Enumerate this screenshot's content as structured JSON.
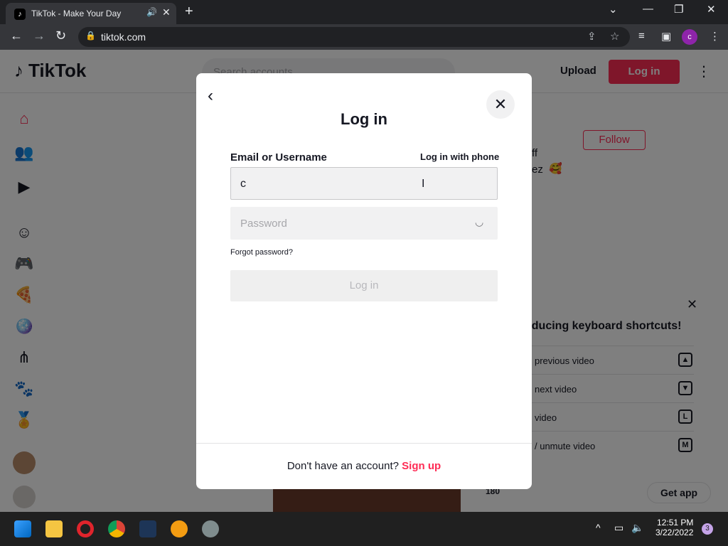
{
  "browser": {
    "tab_title": "TikTok - Make Your Day",
    "url": "tiktok.com",
    "profile_initial": "c"
  },
  "header": {
    "logo_text": "TikTok",
    "search_placeholder": "Search accounts",
    "upload_label": "Upload",
    "login_label": "Log in"
  },
  "background": {
    "follow_label": "Follow",
    "partial_name_1": "ff",
    "partial_name_2": "ez",
    "keyboard_title": "oducing keyboard shortcuts!",
    "shortcuts": [
      {
        "label": "previous video",
        "key": "▲"
      },
      {
        "label": "next video",
        "key": "▼"
      },
      {
        "label": "video",
        "key": "L"
      },
      {
        "label": "/ unmute video",
        "key": "M"
      }
    ],
    "count": "180",
    "get_app_label": "Get app"
  },
  "modal": {
    "title": "Log in",
    "email_label": "Email or Username",
    "phone_link": "Log in with phone",
    "email_value": "c",
    "password_placeholder": "Password",
    "forgot_label": "Forgot password?",
    "login_button": "Log in",
    "footer_text": "Don't have an account?",
    "signup_label": "Sign up"
  },
  "taskbar": {
    "time": "12:51 PM",
    "date": "3/22/2022",
    "notification_count": "3"
  },
  "colors": {
    "brand": "#fe2c55",
    "text": "#161823"
  }
}
